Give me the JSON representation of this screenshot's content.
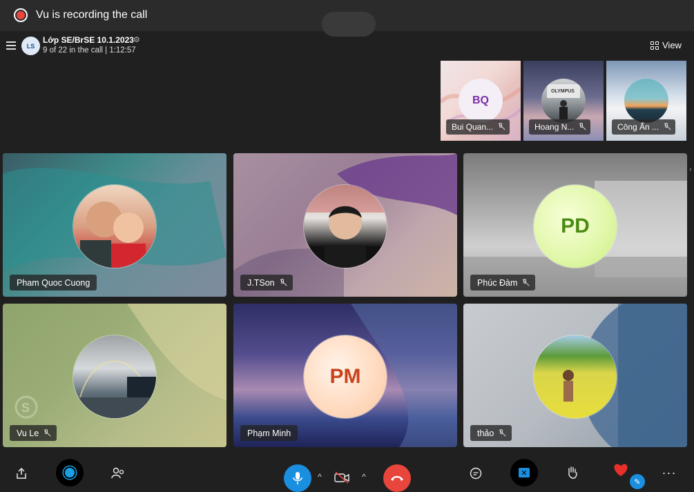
{
  "recording": {
    "text": "Vu is recording the call"
  },
  "header": {
    "group_initials": "LS",
    "title": "Lớp SE/BrSE 10.1.2023",
    "subtitle": "9 of 22 in the call | 1:12:57",
    "view_label": "View"
  },
  "thumbnails": [
    {
      "name": "Bui Quan...",
      "initials": "BQ",
      "muted": true
    },
    {
      "name": "Hoang N...",
      "initials": "",
      "muted": true
    },
    {
      "name": "Công Ấn ...",
      "initials": "",
      "muted": true
    }
  ],
  "tiles": [
    {
      "name": "Pham Quoc Cuong",
      "initials": "",
      "muted": false,
      "active": true
    },
    {
      "name": "J.TSon",
      "initials": "",
      "muted": true
    },
    {
      "name": "Phúc Đàm",
      "initials": "PD",
      "muted": true
    },
    {
      "name": "Vu Le",
      "initials": "",
      "muted": true
    },
    {
      "name": "Phạm Minh",
      "initials": "PM",
      "muted": false
    },
    {
      "name": "thảo",
      "initials": "",
      "muted": true
    }
  ],
  "toolbar": {
    "share_icon": "share-icon",
    "record_icon": "record-icon",
    "participants_icon": "participants-icon",
    "mic_icon": "microphone-icon",
    "camera_icon": "camera-off-icon",
    "hangup_icon": "hang-up-icon",
    "chat_icon": "chat-icon",
    "hand_icon": "raise-hand-icon",
    "react_icon": "heart-icon",
    "more_icon": "more-icon"
  },
  "colors": {
    "accent": "#1aa0e6",
    "hangup": "#e8453c",
    "record": "#e8453c",
    "background": "#202020"
  }
}
